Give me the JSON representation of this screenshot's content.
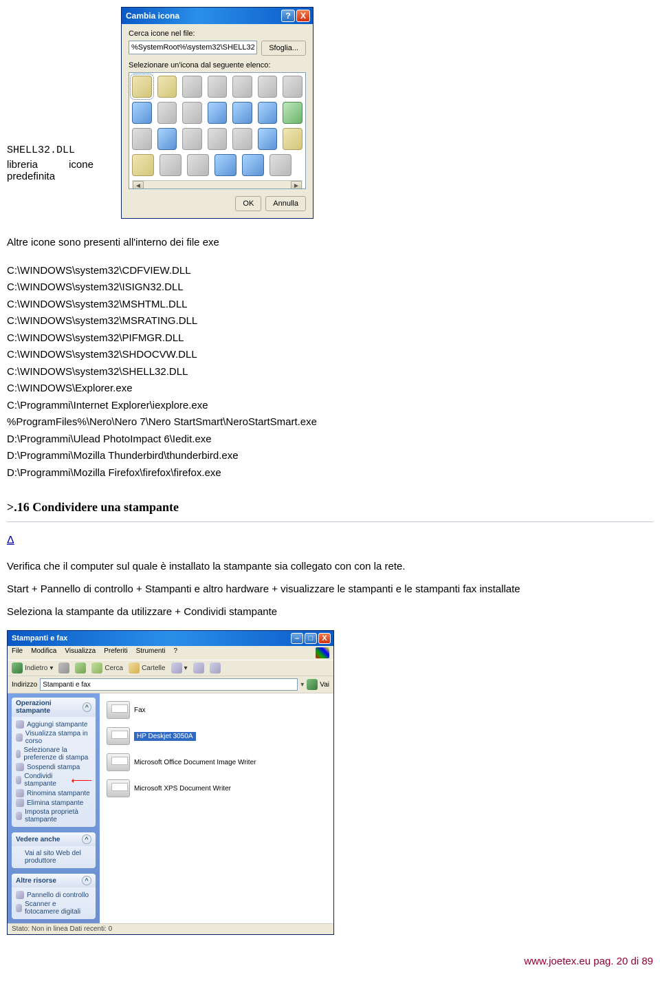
{
  "leftCaption": {
    "line1": "SHELL32.DLL",
    "c1": "libreria",
    "c2": "icone",
    "c3": "predefinita"
  },
  "dialog": {
    "title": "Cambia icona",
    "help": "?",
    "close": "X",
    "searchLabel": "Cerca icone nel file:",
    "pathValue": "%SystemRoot%\\system32\\SHELL32",
    "browse": "Sfoglia...",
    "selectLabel": "Selezionare un'icona dal seguente elenco:",
    "ok": "OK",
    "cancel": "Annulla"
  },
  "paragraphIntro": "Altre icone sono presenti all'interno dei file exe",
  "fileList": [
    "C:\\WINDOWS\\system32\\CDFVIEW.DLL",
    "C:\\WINDOWS\\system32\\ISIGN32.DLL",
    "C:\\WINDOWS\\system32\\MSHTML.DLL",
    "C:\\WINDOWS\\system32\\MSRATING.DLL",
    "C:\\WINDOWS\\system32\\PIFMGR.DLL",
    "C:\\WINDOWS\\system32\\SHDOCVW.DLL",
    "C:\\WINDOWS\\system32\\SHELL32.DLL",
    "C:\\WINDOWS\\Explorer.exe",
    "C:\\Programmi\\Internet Explorer\\iexplore.exe",
    "%ProgramFiles%\\Nero\\Nero 7\\Nero StartSmart\\NeroStartSmart.exe",
    "D:\\Programmi\\Ulead PhotoImpact 6\\Iedit.exe",
    "D:\\Programmi\\Mozilla Thunderbird\\thunderbird.exe",
    "D:\\Programmi\\Mozilla Firefox\\firefox\\firefox.exe"
  ],
  "sectionTitle": ">.16 Condividere una stampante",
  "deltaSymbol": "Δ",
  "para1": "Verifica che il computer sul quale è installato la stampante sia collegato con con la rete.",
  "para2": "Start + Pannello di controllo + Stampanti e altro hardware + visualizzare le stampanti e le stampanti fax installate",
  "para3": "Seleziona la stampante da utilizzare + Condividi stampante",
  "printerWin": {
    "title": "Stampanti e fax",
    "minimize": "–",
    "maximize": "□",
    "close": "X",
    "menus": [
      "File",
      "Modifica",
      "Visualizza",
      "Preferiti",
      "Strumenti",
      "?"
    ],
    "back": "Indietro",
    "search": "Cerca",
    "folders": "Cartelle",
    "addrLabel": "Indirizzo",
    "addrValue": "Stampanti e fax",
    "go": "Vai",
    "sidebar": {
      "opsTitle": "Operazioni stampante",
      "ops": [
        "Aggiungi stampante",
        "Visualizza stampa in corso",
        "Selezionare la preferenze di stampa",
        "Sospendi stampa",
        "Condividi stampante",
        "Rinomina stampante",
        "Elimina stampante",
        "Imposta proprietà stampante"
      ],
      "seeAlsoTitle": "Vedere anche",
      "seeAlso": [
        "Vai al sito Web del produttore"
      ],
      "otherTitle": "Altre risorse",
      "other": [
        "Pannello di controllo",
        "Scanner e fotocamere digitali"
      ]
    },
    "printers": [
      {
        "name": "Fax",
        "selected": false
      },
      {
        "name": "HP Deskjet 3050A",
        "selected": true
      },
      {
        "name": "Microsoft Office Document Image Writer",
        "selected": false
      },
      {
        "name": "Microsoft XPS Document Writer",
        "selected": false
      }
    ],
    "status": "Stato: Non in linea Dati recenti: 0"
  },
  "footer": "www.joetex.eu pag. 20 di 89"
}
